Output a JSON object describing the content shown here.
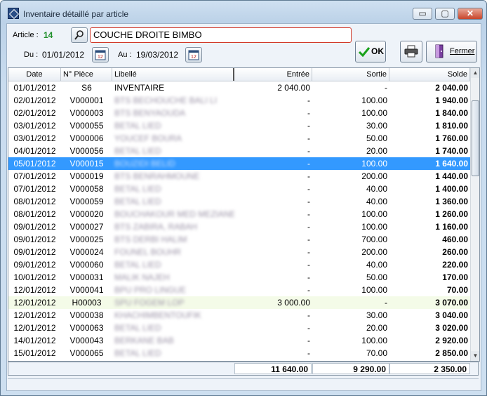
{
  "window": {
    "title": "Inventaire détaillé par article",
    "min_glyph": "▭",
    "max_glyph": "▢",
    "close_glyph": "✕"
  },
  "filters": {
    "article_label": "Article :",
    "article_code": "14",
    "article_name": "COUCHE DROITE BIMBO",
    "du_label": "Du :",
    "du_value": "01/01/2012",
    "au_label": "Au :",
    "au_value": "19/03/2012"
  },
  "buttons": {
    "ok": "OK",
    "fermer": "Fermer"
  },
  "columns": {
    "date": "Date",
    "piece": "N° Pièce",
    "libelle": "Libellé",
    "entree": "Entrée",
    "sortie": "Sortie",
    "solde": "Solde"
  },
  "rows": [
    {
      "date": "01/01/2012",
      "piece": "S6",
      "libelle": "INVENTAIRE",
      "entree": "2 040.00",
      "sortie": "-",
      "solde": "2 040.00"
    },
    {
      "date": "02/01/2012",
      "piece": "V000001",
      "libelle": "BTS BECHOUCHE BALI LI",
      "entree": "-",
      "sortie": "100.00",
      "solde": "1 940.00"
    },
    {
      "date": "02/01/2012",
      "piece": "V000003",
      "libelle": "BTS BENYAOUDA",
      "entree": "-",
      "sortie": "100.00",
      "solde": "1 840.00"
    },
    {
      "date": "03/01/2012",
      "piece": "V000055",
      "libelle": "BETAL LIED",
      "entree": "-",
      "sortie": "30.00",
      "solde": "1 810.00"
    },
    {
      "date": "03/01/2012",
      "piece": "V000006",
      "libelle": "YOUCEF BOURA",
      "entree": "-",
      "sortie": "50.00",
      "solde": "1 760.00"
    },
    {
      "date": "04/01/2012",
      "piece": "V000056",
      "libelle": "BETAL LIED",
      "entree": "-",
      "sortie": "20.00",
      "solde": "1 740.00"
    },
    {
      "date": "05/01/2012",
      "piece": "V000015",
      "libelle": "BOUZIDI BELID",
      "entree": "-",
      "sortie": "100.00",
      "solde": "1 640.00"
    },
    {
      "date": "07/01/2012",
      "piece": "V000019",
      "libelle": "BTS BENRAHMOUNE",
      "entree": "-",
      "sortie": "200.00",
      "solde": "1 440.00"
    },
    {
      "date": "07/01/2012",
      "piece": "V000058",
      "libelle": "BETAL LIED",
      "entree": "-",
      "sortie": "40.00",
      "solde": "1 400.00"
    },
    {
      "date": "08/01/2012",
      "piece": "V000059",
      "libelle": "BETAL LIED",
      "entree": "-",
      "sortie": "40.00",
      "solde": "1 360.00"
    },
    {
      "date": "08/01/2012",
      "piece": "V000020",
      "libelle": "BOUCHAKOUR MED MEZIANE",
      "entree": "-",
      "sortie": "100.00",
      "solde": "1 260.00"
    },
    {
      "date": "09/01/2012",
      "piece": "V000027",
      "libelle": "BTS ZABIRA, RABAH",
      "entree": "-",
      "sortie": "100.00",
      "solde": "1 160.00"
    },
    {
      "date": "09/01/2012",
      "piece": "V000025",
      "libelle": "BTS DERBI HALIM",
      "entree": "-",
      "sortie": "700.00",
      "solde": "460.00"
    },
    {
      "date": "09/01/2012",
      "piece": "V000024",
      "libelle": "FOUNEL BOUHR",
      "entree": "-",
      "sortie": "200.00",
      "solde": "260.00"
    },
    {
      "date": "09/01/2012",
      "piece": "V000060",
      "libelle": "BETAL LIED",
      "entree": "-",
      "sortie": "40.00",
      "solde": "220.00"
    },
    {
      "date": "10/01/2012",
      "piece": "V000031",
      "libelle": "MALIK NAJEH",
      "entree": "-",
      "sortie": "50.00",
      "solde": "170.00"
    },
    {
      "date": "12/01/2012",
      "piece": "V000041",
      "libelle": "BPU PRO LINGUE",
      "entree": "-",
      "sortie": "100.00",
      "solde": "70.00"
    },
    {
      "date": "12/01/2012",
      "piece": "H00003",
      "libelle": "SPU FOGEM LOP",
      "entree": "3 000.00",
      "sortie": "-",
      "solde": "3 070.00"
    },
    {
      "date": "12/01/2012",
      "piece": "V000038",
      "libelle": "KHACHIMBENTOUFIK",
      "entree": "-",
      "sortie": "30.00",
      "solde": "3 040.00"
    },
    {
      "date": "12/01/2012",
      "piece": "V000063",
      "libelle": "BETAL LIED",
      "entree": "-",
      "sortie": "20.00",
      "solde": "3 020.00"
    },
    {
      "date": "14/01/2012",
      "piece": "V000043",
      "libelle": "BERKANE BAB",
      "entree": "-",
      "sortie": "100.00",
      "solde": "2 920.00"
    },
    {
      "date": "15/01/2012",
      "piece": "V000065",
      "libelle": "BETAL LIED",
      "entree": "-",
      "sortie": "70.00",
      "solde": "2 850.00"
    }
  ],
  "totals": {
    "entree": "11 640.00",
    "sortie": "9 290.00",
    "solde": "2 350.00"
  },
  "colors": {
    "selected_row": "#3399ff",
    "article_code": "#1f8f2a",
    "ok_check": "#1aa11a"
  }
}
